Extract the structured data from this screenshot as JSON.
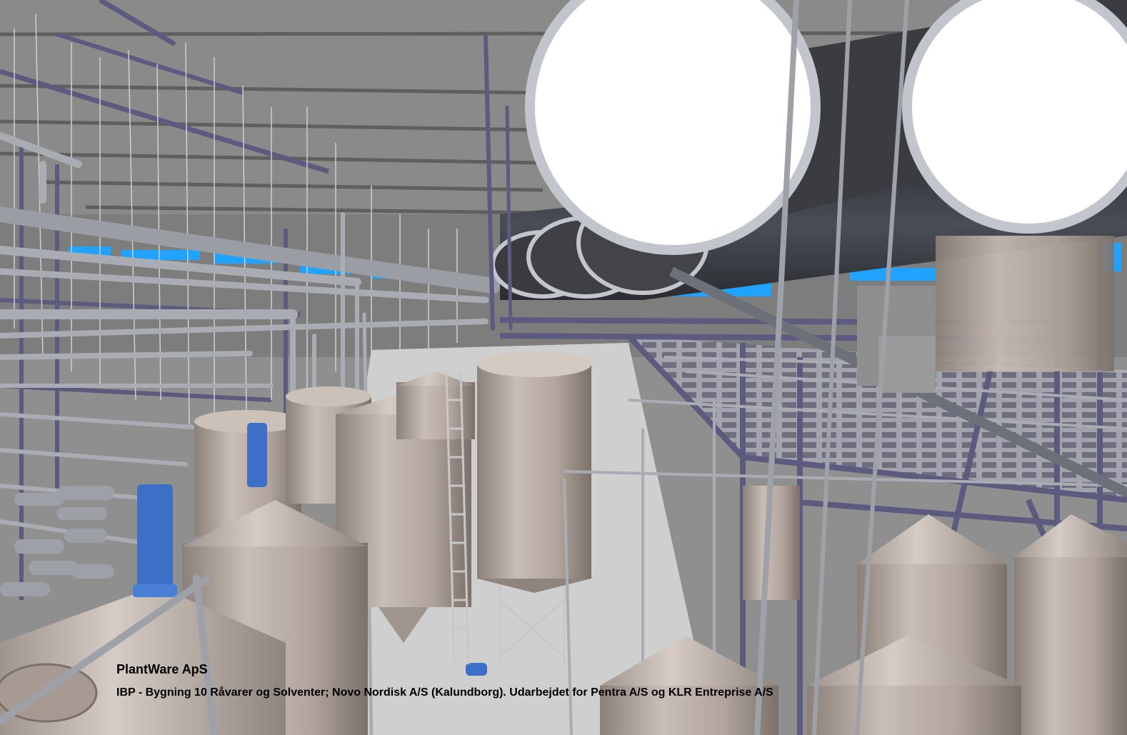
{
  "caption": {
    "company": "PlantWare ApS",
    "description": "IBP - Bygning 10 Råvarer og Solventer; Novo Nordisk A/S (Kalundborg). Udarbejdet for Pentra A/S og KLR Entreprise A/S"
  },
  "colors": {
    "ceiling": "#8a8a8a",
    "wall": "#7d7d7d",
    "floor": "#c9c9c9",
    "pipe": "#a9adb3",
    "steel": "#5d5a80",
    "tank": "#b3a79f",
    "duct": "#3c3e44",
    "window": "#1fa3ff",
    "motor": "#3d6fc7"
  }
}
